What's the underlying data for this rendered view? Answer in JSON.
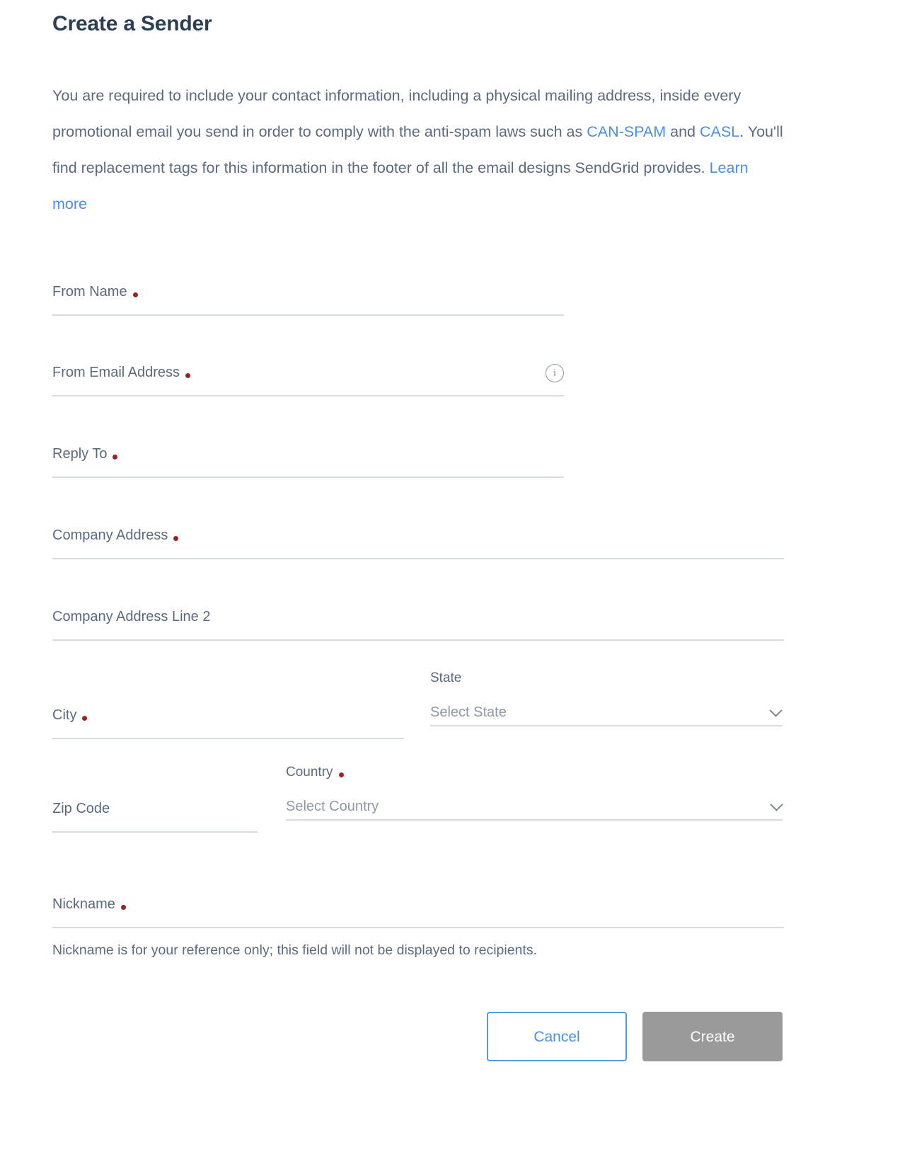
{
  "page": {
    "title": "Create a Sender"
  },
  "intro": {
    "part1": "You are required to include your contact information, including a physical mailing address, inside every promotional email you send in order to comply with the anti-spam laws such as ",
    "link_canspam": "CAN-SPAM",
    "part2": " and ",
    "link_casl": "CASL",
    "part3": ". You'll find replacement tags for this information in the footer of all the email designs SendGrid provides. ",
    "link_learn_more": "Learn more"
  },
  "form": {
    "from_name": {
      "label": "From Name",
      "required": true,
      "value": ""
    },
    "from_email": {
      "label": "From Email Address",
      "required": true,
      "value": "",
      "info_icon": "info-icon"
    },
    "reply_to": {
      "label": "Reply To",
      "required": true,
      "value": ""
    },
    "company_address": {
      "label": "Company Address",
      "required": true,
      "value": ""
    },
    "company_address_2": {
      "label": "Company Address Line 2",
      "required": false,
      "value": ""
    },
    "city": {
      "label": "City",
      "required": true,
      "value": ""
    },
    "state": {
      "label": "State",
      "required": false,
      "placeholder": "Select State",
      "value": "",
      "chevron": "chevron-down-icon"
    },
    "zip": {
      "label": "Zip Code",
      "required": false,
      "value": ""
    },
    "country": {
      "label": "Country",
      "required": true,
      "placeholder": "Select Country",
      "value": "",
      "chevron": "chevron-down-icon"
    },
    "nickname": {
      "label": "Nickname",
      "required": true,
      "value": ""
    },
    "nickname_helper": "Nickname is for your reference only; this field will not be displayed to recipients."
  },
  "actions": {
    "cancel": "Cancel",
    "create": "Create"
  },
  "colors": {
    "title": "#2c3e52",
    "body_text": "#5a6b80",
    "link": "#4a90e2",
    "required_dot": "#9b2222",
    "field_underline": "#d7dce1",
    "placeholder": "#8e99a6",
    "cancel_border": "#5b9bd5",
    "create_bg": "#9a9a9a"
  }
}
